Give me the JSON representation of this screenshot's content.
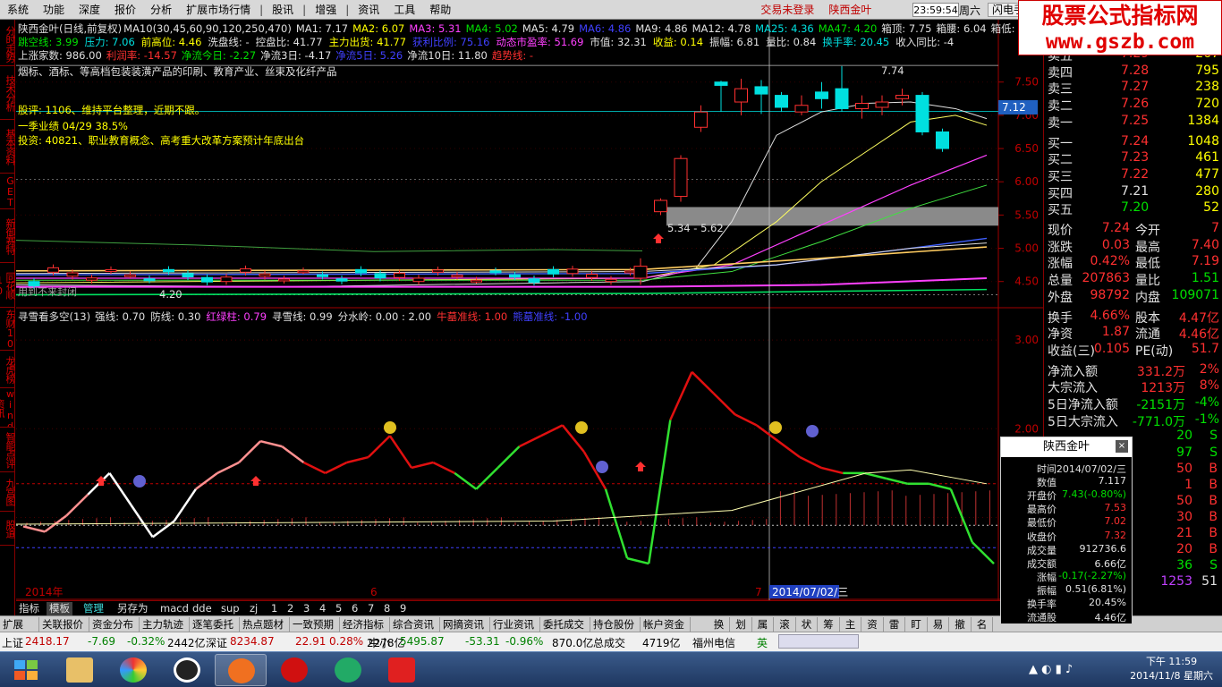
{
  "menu": {
    "items": [
      "系统",
      "功能",
      "深度",
      "报价",
      "分析",
      "扩展市场行情",
      "|",
      "股讯",
      "|",
      "增强",
      "|",
      "资讯",
      "工具",
      "帮助"
    ],
    "login": "交易未登录",
    "stock": "陕西金叶",
    "clock": "23:59:54",
    "weekday": "周六",
    "flash": "闪电手"
  },
  "logo": {
    "line1": "股票公式指标网",
    "line2": "www.gszb.com"
  },
  "sidetabs": [
    "分时走势",
    "技术分析",
    "基本资料",
    "GET",
    "新御赛特",
    "同花顺10",
    "东财10",
    "龙虎榜",
    "wind资讯",
    "智能点评",
    "九宫图",
    "股道"
  ],
  "header": {
    "title": "陕西金叶(日线,前复权)",
    "ma_params": "MA10(30,45,60,90,120,250,470)",
    "ma": [
      {
        "t": "MA1: 7.17",
        "c": "w"
      },
      {
        "t": "MA2: 6.07",
        "c": "y"
      },
      {
        "t": "MA3: 5.31",
        "c": "m"
      },
      {
        "t": "MA4: 5.02",
        "c": "g"
      },
      {
        "t": "MA5: 4.79",
        "c": "w"
      },
      {
        "t": "MA6: 4.86",
        "c": "b"
      },
      {
        "t": "MA9: 4.86",
        "c": "w"
      },
      {
        "t": "MA12: 4.78",
        "c": "w"
      },
      {
        "t": "MA25: 4.36",
        "c": "c"
      },
      {
        "t": "MA47: 4.20",
        "c": "g"
      },
      {
        "t": "箱顶: 7.75",
        "c": "w"
      },
      {
        "t": "箱腰: 6.04",
        "c": "w"
      },
      {
        "t": "箱低: 4.3",
        "c": "w"
      }
    ],
    "row2": [
      {
        "t": "跳空线: 3.99",
        "c": "g"
      },
      {
        "t": "压力: 7.06",
        "c": "c"
      },
      {
        "t": "前高位: 4.46",
        "c": "y"
      },
      {
        "t": "洗盘线: -",
        "c": "w"
      },
      {
        "t": "控盘比: 41.77",
        "c": "w"
      },
      {
        "t": "主力出货: 41.77",
        "c": "y"
      },
      {
        "t": "获利比例: 75.16",
        "c": "b"
      },
      {
        "t": "动态市盈率: 51.69",
        "c": "m"
      },
      {
        "t": "市值: 32.31",
        "c": "w"
      },
      {
        "t": "收益: 0.14",
        "c": "y"
      },
      {
        "t": "振幅: 6.81",
        "c": "w"
      },
      {
        "t": "量比: 0.84",
        "c": "w"
      },
      {
        "t": "换手率: 20.45",
        "c": "c"
      },
      {
        "t": "收入同比: -4",
        "c": "w"
      }
    ],
    "row3": [
      {
        "t": "上涨家数: 986.00",
        "c": "w"
      },
      {
        "t": "利润率: -14.57",
        "c": "r"
      },
      {
        "t": "净流今日: -2.27",
        "c": "g"
      },
      {
        "t": "净流3日: -4.17",
        "c": "w"
      },
      {
        "t": "净流5日: 5.26",
        "c": "b"
      },
      {
        "t": "净流10日: 11.80",
        "c": "w"
      },
      {
        "t": "趋势线: -",
        "c": "r"
      }
    ],
    "industry": "烟标、酒标、等高档包装装潢产品的印刷、教育产业、丝束及化纤产品",
    "note1": "股评: 1106、维持平台整理，近期不跟。",
    "note2": "一季业绩  04/29 38.5%",
    "note3": "投资: 40821、职业教育概念、高考重大改革方案预计年底出台",
    "box_label": "5.34 - 5.62",
    "high_label": "7.74",
    "low_label": "4.20",
    "bottom_watermark": "用到不来封闭"
  },
  "indicator": {
    "title": "寻雪看多空(13)",
    "items": [
      {
        "t": "强线: 0.70",
        "c": "w"
      },
      {
        "t": "防线: 0.30",
        "c": "w"
      },
      {
        "t": "红绿柱: 0.79",
        "c": "m"
      },
      {
        "t": "寻雪线: 0.99",
        "c": "w"
      },
      {
        "t": "分水岭: 0.00 : 2.00",
        "c": "w"
      },
      {
        "t": "牛墓准线: 1.00",
        "c": "r"
      },
      {
        "t": "熊墓准线: -1.00",
        "c": "b"
      }
    ]
  },
  "axis_top": {
    "ticks": [
      "7.50",
      "7.00",
      "6.50",
      "6.00",
      "5.50",
      "5.00",
      "4.50"
    ],
    "price_tag": "7.12"
  },
  "axis_bottom": {
    "ticks": [
      "3.00",
      "2.00",
      "1.00"
    ]
  },
  "xaxis": {
    "labels": [
      "2014年",
      "6",
      "7"
    ],
    "crosshair_date": "2014/07/02/三"
  },
  "chart_data": {
    "type": "candlestick",
    "title": "陕西金叶(日线,前复权)",
    "ylim": [
      4.2,
      7.9
    ],
    "candles_recent": [
      {
        "o": 4.55,
        "c": 4.73,
        "h": 4.85,
        "l": 4.45
      },
      {
        "o": 5.55,
        "c": 5.72,
        "h": 5.75,
        "l": 5.5
      },
      {
        "o": 5.78,
        "c": 6.35,
        "h": 6.4,
        "l": 5.7
      },
      {
        "o": 6.82,
        "c": 7.05,
        "h": 7.15,
        "l": 6.75
      },
      {
        "o": 7.5,
        "c": 7.45,
        "h": 7.52,
        "l": 7.05
      },
      {
        "o": 7.2,
        "c": 7.4,
        "h": 7.55,
        "l": 7.0
      },
      {
        "o": 7.43,
        "c": 7.32,
        "h": 7.53,
        "l": 7.02
      },
      {
        "o": 7.3,
        "c": 7.12,
        "h": 7.35,
        "l": 7.05
      },
      {
        "o": 7.05,
        "c": 7.15,
        "h": 7.3,
        "l": 7.0
      },
      {
        "o": 7.35,
        "c": 7.25,
        "h": 7.5,
        "l": 7.1
      },
      {
        "o": 7.4,
        "c": 7.1,
        "h": 7.74,
        "l": 7.05
      },
      {
        "o": 7.1,
        "c": 7.18,
        "h": 7.3,
        "l": 6.95
      },
      {
        "o": 7.12,
        "c": 7.2,
        "h": 7.3,
        "l": 7.0
      },
      {
        "o": 7.25,
        "c": 7.3,
        "h": 7.4,
        "l": 7.15
      },
      {
        "o": 7.3,
        "c": 6.75,
        "h": 7.35,
        "l": 6.7
      },
      {
        "o": 6.75,
        "c": 6.5,
        "h": 6.8,
        "l": 6.45
      }
    ],
    "indicator_series": [
      0.95,
      0.9,
      1.05,
      1.25,
      1.45,
      1.15,
      0.85,
      1.0,
      1.3,
      1.45,
      1.55,
      1.75,
      1.7,
      1.55,
      1.45,
      1.55,
      1.6,
      1.8,
      1.5,
      1.55,
      1.45,
      1.3,
      1.5,
      1.7,
      1.8,
      1.9,
      1.65,
      1.3,
      0.65,
      0.6,
      1.95,
      2.4,
      2.2,
      2.0,
      1.9,
      1.75,
      1.6,
      1.5,
      1.45,
      1.45,
      1.4,
      1.35,
      1.35,
      1.3,
      0.8,
      0.6
    ]
  },
  "quotes": {
    "sell": [
      {
        "n": "卖五",
        "p": "7.29",
        "v": "267"
      },
      {
        "n": "卖四",
        "p": "7.28",
        "v": "795"
      },
      {
        "n": "卖三",
        "p": "7.27",
        "v": "238"
      },
      {
        "n": "卖二",
        "p": "7.26",
        "v": "720"
      },
      {
        "n": "卖一",
        "p": "7.25",
        "v": "1384"
      }
    ],
    "buy": [
      {
        "n": "买一",
        "p": "7.24",
        "v": "1048"
      },
      {
        "n": "买二",
        "p": "7.23",
        "v": "461"
      },
      {
        "n": "买三",
        "p": "7.22",
        "v": "477"
      },
      {
        "n": "买四",
        "p": "7.21",
        "v": "280"
      },
      {
        "n": "买五",
        "p": "7.20",
        "v": "52"
      }
    ],
    "stats": [
      {
        "k1": "现价",
        "v1": "7.24",
        "k2": "今开",
        "v2": "7"
      },
      {
        "k1": "涨跌",
        "v1": "0.03",
        "k2": "最高",
        "v2": "7.40"
      },
      {
        "k1": "涨幅",
        "v1": "0.42%",
        "k2": "最低",
        "v2": "7.19"
      },
      {
        "k1": "总量",
        "v1": "207863",
        "k2": "量比",
        "v2": "1.51"
      },
      {
        "k1": "外盘",
        "v1": "98792",
        "k2": "内盘",
        "v2": "109071"
      }
    ],
    "stats2": [
      {
        "k1": "换手",
        "v1": "4.66%",
        "k2": "股本",
        "v2": "4.47亿"
      },
      {
        "k1": "净资",
        "v1": "1.87",
        "k2": "流通",
        "v2": "4.46亿"
      },
      {
        "k1": "收益(三)",
        "v1": "0.105",
        "k2": "PE(动)",
        "v2": "51.7"
      }
    ],
    "flows": [
      {
        "k": "净流入额",
        "v": "331.2万",
        "p": "2%",
        "c": "r"
      },
      {
        "k": "大宗流入",
        "v": "1213万",
        "p": "8%",
        "c": "r"
      },
      {
        "k": "5日净流入额",
        "v": "-2151万",
        "p": "-4%",
        "c": "g"
      },
      {
        "k": "5日大宗流入",
        "v": "-771.0万",
        "p": "-1%",
        "c": "g"
      }
    ],
    "ticks": [
      {
        "v": "20",
        "s": "S"
      },
      {
        "v": "97",
        "s": "S"
      },
      {
        "v": "50",
        "s": "B"
      },
      {
        "v": "1",
        "s": "B"
      },
      {
        "v": "50",
        "s": "B"
      },
      {
        "v": "30",
        "s": "B"
      },
      {
        "v": "21",
        "s": "B"
      },
      {
        "v": "20",
        "s": "B"
      },
      {
        "v": "36",
        "s": "S"
      },
      {
        "v": "1253",
        "s": "51"
      }
    ]
  },
  "popup": {
    "title": "陕西金叶",
    "rows": [
      {
        "k": "时间",
        "v": "2014/07/02/三",
        "c": "w"
      },
      {
        "k": "数值",
        "v": "7.117",
        "c": "w"
      },
      {
        "k": "开盘价",
        "v": "7.43(-0.80%)",
        "c": "g"
      },
      {
        "k": "最高价",
        "v": "7.53",
        "c": "r"
      },
      {
        "k": "最低价",
        "v": "7.02",
        "c": "r"
      },
      {
        "k": "收盘价",
        "v": "7.32",
        "c": "r"
      },
      {
        "k": "成交量",
        "v": "912736.6",
        "c": "w"
      },
      {
        "k": "成交额",
        "v": "6.66亿",
        "c": "w"
      },
      {
        "k": "涨幅",
        "v": "-0.17(-2.27%)",
        "c": "g"
      },
      {
        "k": "振幅",
        "v": "0.51(6.81%)",
        "c": "w"
      },
      {
        "k": "换手率",
        "v": "20.45%",
        "c": "w"
      },
      {
        "k": "流通股",
        "v": "4.46亿",
        "c": "w"
      }
    ]
  },
  "bottom_tabs": [
    "指标",
    "模板",
    "管理",
    "另存为",
    "macd",
    "dde",
    "sup",
    "zj",
    "1",
    "2",
    "3",
    "4",
    "5",
    "6",
    "7",
    "8",
    "9"
  ],
  "func_tabs": [
    "扩展",
    "关联报价",
    "资金分布",
    "主力轨迹",
    "逐笔委托",
    "热点题材",
    "一致预期",
    "经济指标",
    "综合资讯",
    "网摘资讯",
    "行业资讯",
    "委托成交",
    "持仓股份",
    "帐户资金"
  ],
  "func_right": [
    "换",
    "划",
    "属",
    "滚",
    "状",
    "筹",
    "主",
    "资",
    "雷",
    "盯",
    "易",
    "撤",
    "名"
  ],
  "status": {
    "sh_label": "上证",
    "sh": "2418.17",
    "sh_chg": "-7.69",
    "sh_pct": "-0.32%",
    "sh_amt": "2442亿",
    "sz_label": "深证",
    "sz": "8234.87",
    "sz_chg": "22.91",
    "sz_pct": "0.28%",
    "sz_amt": "2278亿",
    "zx_label": "中小",
    "zx": "5495.87",
    "zx_chg": "-53.31",
    "zx_pct": "-0.96%",
    "zx_amt": "870.0亿",
    "deal_label": "总成交",
    "deal": "4719亿",
    "isp": "福州电信",
    "ime": "英"
  },
  "taskbar": {
    "time": "下午 11:59",
    "date": "2014/11/8 星期六"
  }
}
